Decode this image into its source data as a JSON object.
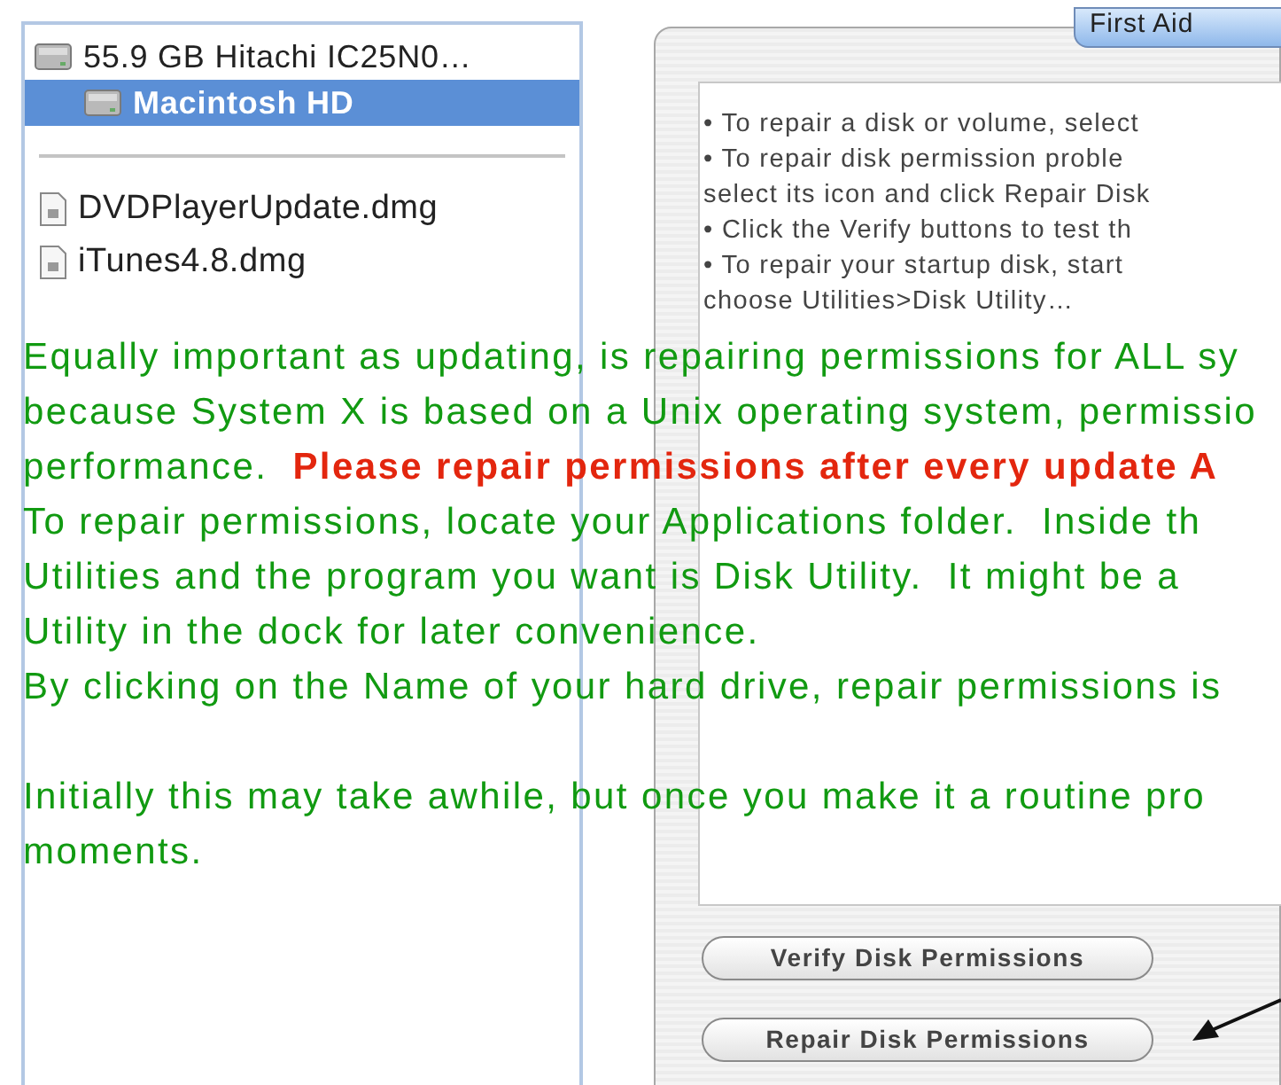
{
  "disk_list": {
    "disks": [
      {
        "label": "55.9 GB Hitachi IC25N0…",
        "selected": false,
        "children": [
          {
            "label": "Macintosh HD",
            "selected": true
          }
        ]
      }
    ],
    "images": [
      {
        "label": "DVDPlayerUpdate.dmg",
        "selected": false
      },
      {
        "label": "iTunes4.8.dmg",
        "selected": false
      }
    ]
  },
  "first_aid": {
    "tab": "First Aid",
    "instructions": [
      "• To repair a disk or volume, select",
      "• To repair disk permission proble",
      "select its icon and click Repair Disk",
      "• Click the Verify buttons to test th",
      "• To repair your startup disk, start",
      "choose Utilities>Disk Utility…"
    ],
    "buttons": [
      "Verify Disk Permissions",
      "Repair Disk Permissions"
    ]
  },
  "article": {
    "paragraphs": [
      [
        "Equally important as updating, is repairing permissions for ALL sy",
        "because System X is based on a Unix operating system, permissio",
        "performance.  **Please repair permissions after every update A**",
        "To repair permissions, locate your Applications folder.  Inside th",
        "Utilities and the program you want is Disk Utility.  It might be a",
        "Utility in the dock for later convenience.",
        "By clicking on the Name of your hard drive, repair permissions is"
      ],
      [
        "Initially this may take awhile, but once you make it a routine pro",
        "moments."
      ]
    ]
  }
}
